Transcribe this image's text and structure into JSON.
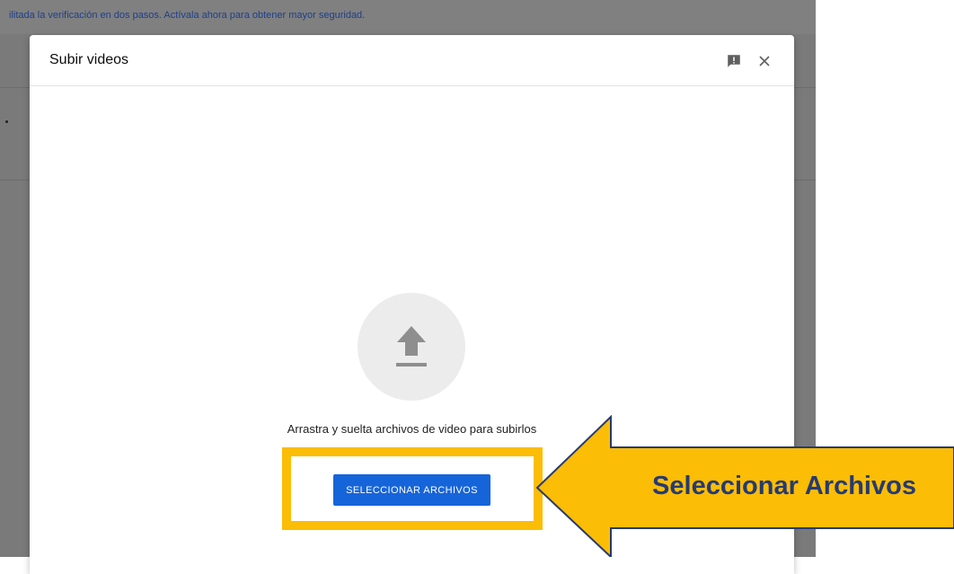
{
  "banner": {
    "text": "ilitada la verificación en dos pasos. Actívala ahora para obtener mayor seguridad."
  },
  "dialog": {
    "title": "Subir videos",
    "feedback_icon": "feedback-icon",
    "close_icon": "close-icon",
    "upload_icon": "upload-arrow-icon",
    "drop_text": "Arrastra y suelta archivos de video para subirlos",
    "select_button_label": "SELECCIONAR ARCHIVOS"
  },
  "callout": {
    "label": "Seleccionar Archivos",
    "highlight_color": "#fbbd05",
    "text_color": "#263a73"
  },
  "colors": {
    "accent": "#1664d9",
    "overlay": "#7a7a7a"
  }
}
